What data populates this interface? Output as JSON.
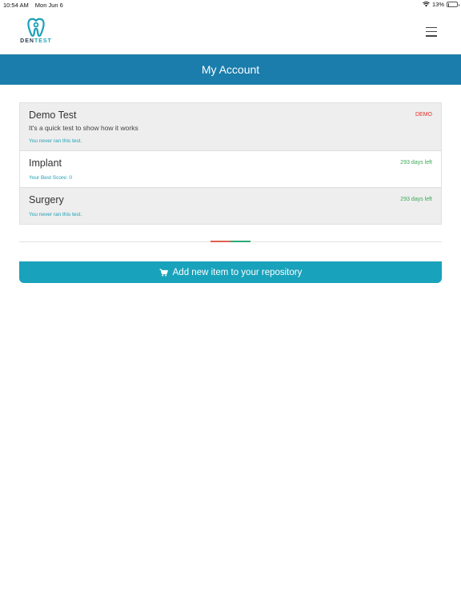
{
  "status_bar": {
    "time": "10:54 AM",
    "date": "Mon Jun 6",
    "battery": "13%",
    "battery_level": 0.13
  },
  "header": {
    "logo_den": "DEN",
    "logo_test": "TEST",
    "icons": {
      "logo": "tooth-icon",
      "menu": "hamburger-menu-icon"
    }
  },
  "page_title": "My Account",
  "items": [
    {
      "title": "Demo Test",
      "description": "It's a quick test to show how it works",
      "meta": "You never ran this test.",
      "badge": "DEMO"
    },
    {
      "title": "Implant",
      "meta": "Your Best Score: 0",
      "badge": "293 days left"
    },
    {
      "title": "Surgery",
      "meta": "You never ran this test.",
      "badge": "293 days left"
    }
  ],
  "add_button": {
    "label": "Add new item to your repository",
    "icon": "cart-icon"
  },
  "colors": {
    "primary": "#1b7dab",
    "accent": "#19a2bb",
    "demo_badge": "#e0312a",
    "days_badge": "#3aaa55"
  }
}
